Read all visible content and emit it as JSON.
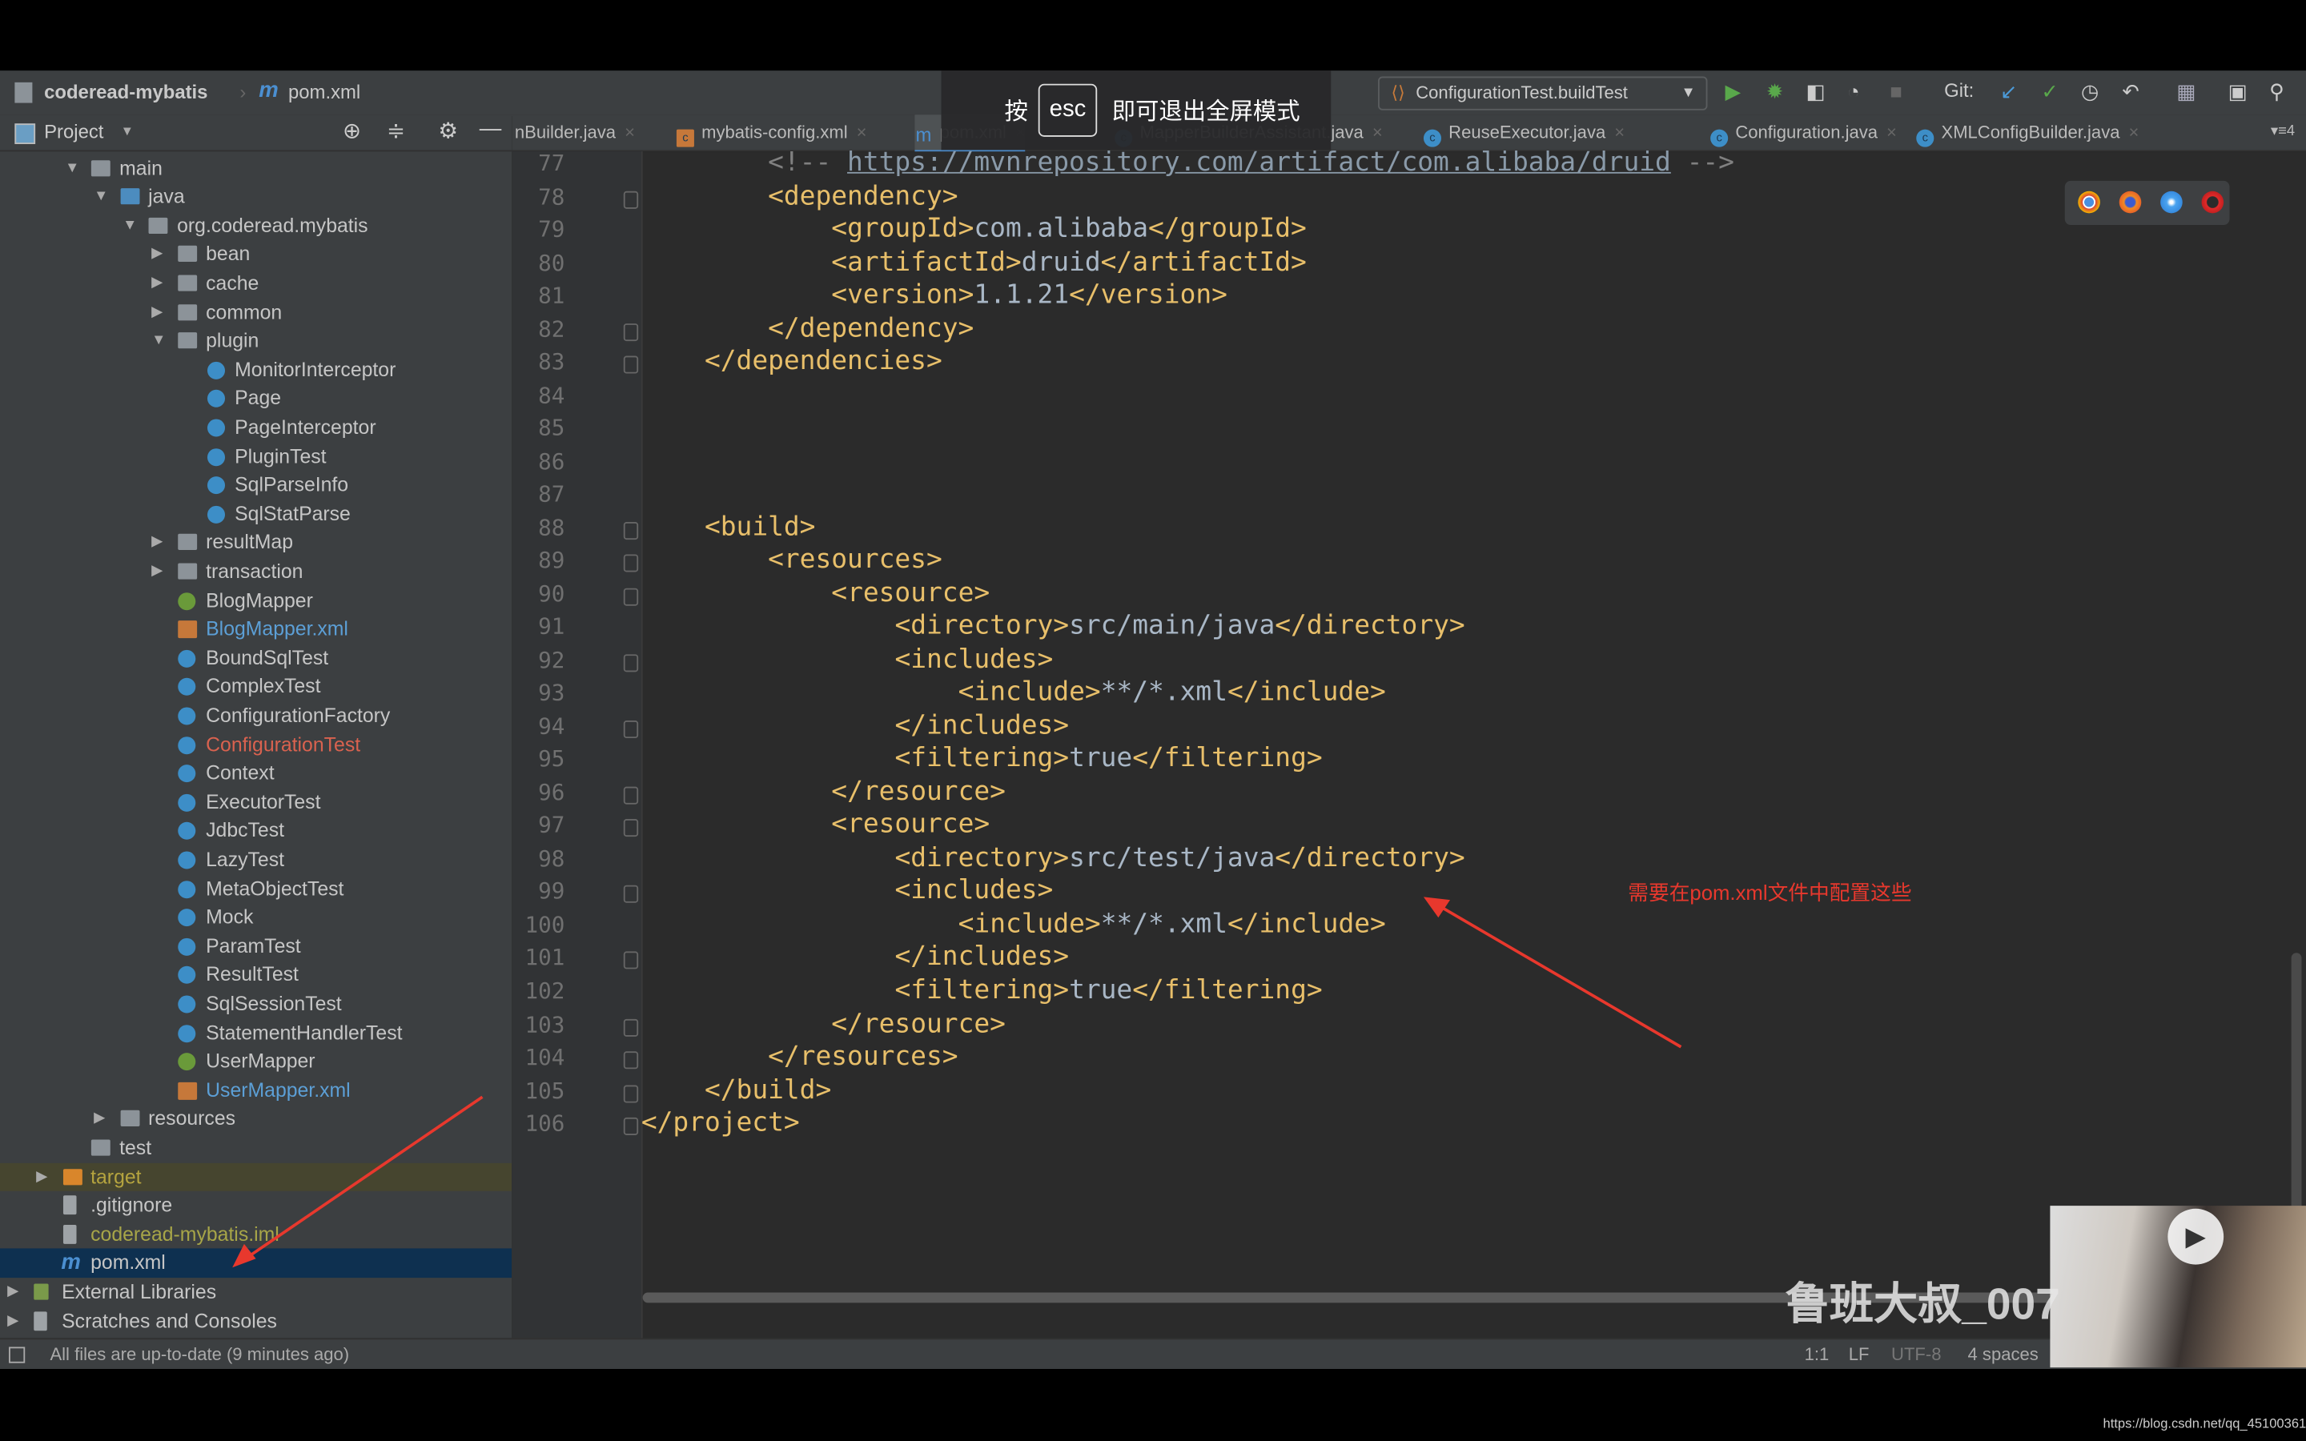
{
  "breadcrumb": {
    "project": "coderead-mybatis",
    "file": "pom.xml"
  },
  "run_config": {
    "label": "ConfigurationTest.buildTest",
    "git_label": "Git:"
  },
  "fullscreen_hint": {
    "before": "按",
    "key": "esc",
    "after": "即可退出全屏模式"
  },
  "project_panel": {
    "title": "Project"
  },
  "tabs": [
    {
      "label": "nBuilder.java",
      "icon": "class-icon"
    },
    {
      "label": "mybatis-config.xml",
      "icon": "xml-icon"
    },
    {
      "label": "pom.xml",
      "icon": "maven-icon",
      "active": true
    },
    {
      "label": "MapperBuilderAssistant.java",
      "icon": "class-icon"
    },
    {
      "label": "ReuseExecutor.java",
      "icon": "class-icon"
    },
    {
      "label": "Configuration.java",
      "icon": "class-icon"
    },
    {
      "label": "XMLConfigBuilder.java",
      "icon": "class-icon"
    }
  ],
  "tabs_overflow": "4",
  "tree": [
    {
      "label": "main",
      "level": 2,
      "arrow": "down",
      "icon": "folder"
    },
    {
      "label": "java",
      "level": 3,
      "arrow": "down",
      "icon": "javafolder"
    },
    {
      "label": "org.coderead.mybatis",
      "level": 4,
      "arrow": "down",
      "icon": "pkg"
    },
    {
      "label": "bean",
      "level": 5,
      "arrow": "right",
      "icon": "pkg"
    },
    {
      "label": "cache",
      "level": 5,
      "arrow": "right",
      "icon": "pkg"
    },
    {
      "label": "common",
      "level": 5,
      "arrow": "right",
      "icon": "pkg"
    },
    {
      "label": "plugin",
      "level": 5,
      "arrow": "down",
      "icon": "pkg"
    },
    {
      "label": "MonitorInterceptor",
      "level": 6,
      "icon": "class"
    },
    {
      "label": "Page",
      "level": 6,
      "icon": "class"
    },
    {
      "label": "PageInterceptor",
      "level": 6,
      "icon": "class"
    },
    {
      "label": "PluginTest",
      "level": 6,
      "icon": "class"
    },
    {
      "label": "SqlParseInfo",
      "level": 6,
      "icon": "class"
    },
    {
      "label": "SqlStatParse",
      "level": 6,
      "icon": "class"
    },
    {
      "label": "resultMap",
      "level": 5,
      "arrow": "right",
      "icon": "pkg"
    },
    {
      "label": "transaction",
      "level": 5,
      "arrow": "right",
      "icon": "pkg"
    },
    {
      "label": "BlogMapper",
      "level": 5,
      "icon": "iface"
    },
    {
      "label": "BlogMapper.xml",
      "level": 5,
      "icon": "xml",
      "color": "#5c9fd6"
    },
    {
      "label": "BoundSqlTest",
      "level": 5,
      "icon": "class"
    },
    {
      "label": "ComplexTest",
      "level": 5,
      "icon": "class"
    },
    {
      "label": "ConfigurationFactory",
      "level": 5,
      "icon": "class"
    },
    {
      "label": "ConfigurationTest",
      "level": 5,
      "icon": "class",
      "color": "#d9624f"
    },
    {
      "label": "Context",
      "level": 5,
      "icon": "class"
    },
    {
      "label": "ExecutorTest",
      "level": 5,
      "icon": "class"
    },
    {
      "label": "JdbcTest",
      "level": 5,
      "icon": "class"
    },
    {
      "label": "LazyTest",
      "level": 5,
      "icon": "class"
    },
    {
      "label": "MetaObjectTest",
      "level": 5,
      "icon": "class"
    },
    {
      "label": "Mock",
      "level": 5,
      "icon": "class"
    },
    {
      "label": "ParamTest",
      "level": 5,
      "icon": "class"
    },
    {
      "label": "ResultTest",
      "level": 5,
      "icon": "class"
    },
    {
      "label": "SqlSessionTest",
      "level": 5,
      "icon": "class"
    },
    {
      "label": "StatementHandlerTest",
      "level": 5,
      "icon": "class"
    },
    {
      "label": "UserMapper",
      "level": 5,
      "icon": "iface"
    },
    {
      "label": "UserMapper.xml",
      "level": 5,
      "icon": "xml",
      "color": "#5c9fd6"
    },
    {
      "label": "resources",
      "level": 3,
      "arrow": "right",
      "icon": "folder"
    },
    {
      "label": "test",
      "level": 2,
      "icon": "folder"
    },
    {
      "label": "target",
      "level": 1,
      "arrow": "right",
      "icon": "orange",
      "color": "#b5a43f",
      "bg": "#46452f"
    },
    {
      "label": ".gitignore",
      "level": 1,
      "icon": "file"
    },
    {
      "label": "coderead-mybatis.iml",
      "level": 1,
      "icon": "file",
      "color": "#a7a548"
    },
    {
      "label": "pom.xml",
      "level": 1,
      "icon": "mvn",
      "bg": "#0e3050",
      "selected": true
    },
    {
      "label": "External Libraries",
      "level": 0,
      "arrow": "right",
      "icon": "lib"
    },
    {
      "label": "Scratches and Consoles",
      "level": 0,
      "arrow": "right",
      "icon": "file"
    }
  ],
  "code": {
    "lines": [
      [
        [
          2,
          ""
        ],
        [
          "cmt",
          "<!-- "
        ],
        [
          "link",
          "https://mvnrepository.com/artifact/com.alibaba/druid"
        ],
        [
          "cmt",
          " -->"
        ]
      ],
      [
        [
          2,
          ""
        ],
        [
          "tag",
          "<dependency>"
        ]
      ],
      [
        [
          3,
          ""
        ],
        [
          "tag",
          "<groupId>"
        ],
        [
          "txtc",
          "com.alibaba"
        ],
        [
          "tag",
          "</groupId>"
        ]
      ],
      [
        [
          3,
          ""
        ],
        [
          "tag",
          "<artifactId>"
        ],
        [
          "txtc",
          "druid"
        ],
        [
          "tag",
          "</artifactId>"
        ]
      ],
      [
        [
          3,
          ""
        ],
        [
          "tag",
          "<version>"
        ],
        [
          "txtc",
          "1.1.21"
        ],
        [
          "tag",
          "</version>"
        ]
      ],
      [
        [
          2,
          ""
        ],
        [
          "tag",
          "</dependency>"
        ]
      ],
      [
        [
          1,
          ""
        ],
        [
          "tag",
          "</dependencies>"
        ]
      ],
      [],
      [],
      [],
      [],
      [
        [
          1,
          ""
        ],
        [
          "tag",
          "<build>"
        ]
      ],
      [
        [
          2,
          ""
        ],
        [
          "tag",
          "<resources>"
        ]
      ],
      [
        [
          3,
          ""
        ],
        [
          "tag",
          "<resource>"
        ]
      ],
      [
        [
          4,
          ""
        ],
        [
          "tag",
          "<directory>"
        ],
        [
          "txtc",
          "src/main/java"
        ],
        [
          "tag",
          "</directory>"
        ]
      ],
      [
        [
          4,
          ""
        ],
        [
          "tag",
          "<includes>"
        ]
      ],
      [
        [
          5,
          ""
        ],
        [
          "tag",
          "<include>"
        ],
        [
          "txtc",
          "**/*.xml"
        ],
        [
          "tag",
          "</include>"
        ]
      ],
      [
        [
          4,
          ""
        ],
        [
          "tag",
          "</includes>"
        ]
      ],
      [
        [
          4,
          ""
        ],
        [
          "tag",
          "<filtering>"
        ],
        [
          "txtc",
          "true"
        ],
        [
          "tag",
          "</filtering>"
        ]
      ],
      [
        [
          3,
          ""
        ],
        [
          "tag",
          "</resource>"
        ]
      ],
      [
        [
          3,
          ""
        ],
        [
          "tag",
          "<resource>"
        ]
      ],
      [
        [
          4,
          ""
        ],
        [
          "tag",
          "<directory>"
        ],
        [
          "txtc",
          "src/test/java"
        ],
        [
          "tag",
          "</directory>"
        ]
      ],
      [
        [
          4,
          ""
        ],
        [
          "tag",
          "<includes>"
        ]
      ],
      [
        [
          5,
          ""
        ],
        [
          "tag",
          "<include>"
        ],
        [
          "txtc",
          "**/*.xml"
        ],
        [
          "tag",
          "</include>"
        ]
      ],
      [
        [
          4,
          ""
        ],
        [
          "tag",
          "</includes>"
        ]
      ],
      [
        [
          4,
          ""
        ],
        [
          "tag",
          "<filtering>"
        ],
        [
          "txtc",
          "true"
        ],
        [
          "tag",
          "</filtering>"
        ]
      ],
      [
        [
          3,
          ""
        ],
        [
          "tag",
          "</resource>"
        ]
      ],
      [
        [
          2,
          ""
        ],
        [
          "tag",
          "</resources>"
        ]
      ],
      [
        [
          1,
          ""
        ],
        [
          "tag",
          "</build>"
        ]
      ],
      [
        [
          0,
          ""
        ],
        [
          "tag",
          "</project>"
        ]
      ]
    ],
    "line_numbers": [
      "77",
      "78",
      "79",
      "80",
      "81",
      "82",
      "83",
      "84",
      "85",
      "86",
      "87",
      "88",
      "89",
      "90",
      "91",
      "92",
      "93",
      "94",
      "95",
      "96",
      "97",
      "98",
      "99",
      "100",
      "101",
      "102",
      "103",
      "104",
      "105",
      "106"
    ]
  },
  "annotation": {
    "text": "需要在pom.xml文件中配置这些",
    "color": "#e8382d"
  },
  "status": {
    "message": "All files are up-to-date (9 minutes ago)",
    "position": "1:1",
    "line_sep": "LF",
    "encoding": "UTF-8",
    "indent": "4 spaces"
  },
  "watermark": {
    "text": "鲁班大叔_007"
  },
  "source_url": "https://blog.csdn.net/qq_45100361",
  "colors": {
    "tag": "#e8bf6a",
    "text": "#a9b7c6",
    "editor_bg": "#2b2b2b",
    "panel_bg": "#3c3f41",
    "selection": "#0e3050"
  }
}
